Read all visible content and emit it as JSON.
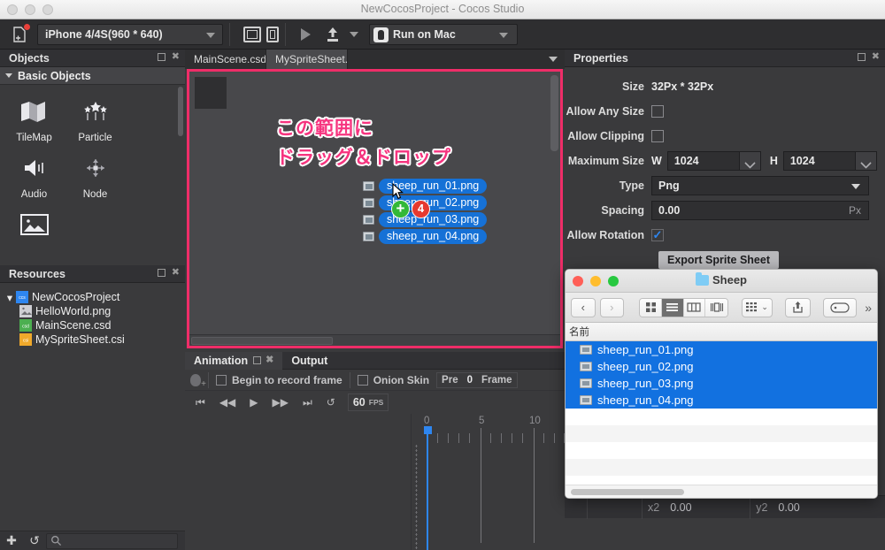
{
  "window": {
    "title": "NewCocosProject - Cocos Studio"
  },
  "toolbar": {
    "new_icon": "new-document-icon",
    "resolution": "iPhone 4/4S(960 * 640)",
    "landscape_icon": "landscape-orientation-icon",
    "portrait_icon": "portrait-orientation-icon",
    "play_icon": "play-icon",
    "publish_icon": "publish-icon",
    "publish_caret_icon": "chevron-down-icon",
    "run_target": "Run on Mac",
    "mac_icon": "apple-mac-icon"
  },
  "objects_panel": {
    "title": "Objects",
    "group": "Basic Objects",
    "items": [
      {
        "label": "TileMap",
        "icon": "tilemap-icon"
      },
      {
        "label": "Particle",
        "icon": "particle-icon"
      },
      {
        "label": "Audio",
        "icon": "audio-icon"
      },
      {
        "label": "Node",
        "icon": "node-icon"
      },
      {
        "label": "",
        "icon": "image-icon"
      }
    ]
  },
  "resources_panel": {
    "title": "Resources",
    "tree": [
      {
        "label": "NewCocosProject",
        "icon": "ccs-project-icon",
        "depth": 0,
        "expanded": true
      },
      {
        "label": "HelloWorld.png",
        "icon": "png-image-icon",
        "depth": 1
      },
      {
        "label": "MainScene.csd",
        "icon": "csd-file-icon",
        "depth": 1
      },
      {
        "label": "MySpriteSheet.csi",
        "icon": "csi-file-icon",
        "depth": 1
      }
    ],
    "footer": {
      "add_icon": "plus-icon",
      "refresh_icon": "refresh-icon",
      "search_icon": "search-icon",
      "search_value": "",
      "search_placeholder": ""
    }
  },
  "editor_tabs": [
    {
      "label": "MainScene.csd",
      "active": false,
      "close_icon": "close-icon"
    },
    {
      "label": "MySpriteSheet.csi",
      "active": true,
      "close_icon": "close-icon"
    }
  ],
  "canvas": {
    "annotation_line1": "この範囲に",
    "annotation_line2": "ドラッグ＆ドロップ",
    "annotation_color": "#f6347f",
    "highlight_border_color": "#ef2d68",
    "drag_items": [
      "sheep_run_01.png",
      "sheep_run_02.png",
      "sheep_run_03.png",
      "sheep_run_04.png"
    ],
    "drag_badge_plus": "+",
    "drag_badge_count": "4",
    "cursor_icon": "mouse-pointer-icon",
    "arrow_icon": "pink-arrow-icon"
  },
  "properties_panel": {
    "title": "Properties",
    "rows": {
      "size_label": "Size",
      "size_value": "32Px * 32Px",
      "allow_any_size_label": "Allow Any Size",
      "allow_any_size_checked": false,
      "allow_clipping_label": "Allow Clipping",
      "allow_clipping_checked": false,
      "maximum_size_label": "Maximum Size",
      "w_label": "W",
      "w_value": "1024",
      "h_label": "H",
      "h_value": "1024",
      "type_label": "Type",
      "type_value": "Png",
      "spacing_label": "Spacing",
      "spacing_value": "0.00",
      "spacing_unit": "Px",
      "allow_rotation_label": "Allow Rotation",
      "allow_rotation_checked": true,
      "export_button": "Export Sprite Sheet"
    }
  },
  "animation_panel": {
    "tabs": [
      {
        "label": "Animation",
        "active": true
      },
      {
        "label": "Output",
        "active": false
      }
    ],
    "record_icon": "record-frame-icon",
    "begin_record_label": "Begin to record frame",
    "begin_record_checked": false,
    "onion_skin_label": "Onion Skin",
    "onion_skin_checked": false,
    "pre_label": "Pre",
    "pre_value": "0",
    "frame_label": "Frame",
    "transport": {
      "first_icon": "skip-to-start-icon",
      "rewind_icon": "rewind-icon",
      "play_icon": "play-icon",
      "forward_icon": "fast-forward-icon",
      "last_icon": "skip-to-end-icon",
      "loop_icon": "loop-icon"
    },
    "fps_value": "60",
    "fps_unit": "FPS",
    "row_caret_icon": "chevron-down-icon",
    "edit_icon": "pencil-icon",
    "add_icon": "plus-icon",
    "timeline": {
      "labels": [
        "0",
        "5",
        "10"
      ],
      "playhead_frame": "0"
    }
  },
  "finder": {
    "folder_name": "Sheep",
    "folder_icon": "folder-icon",
    "back_icon": "chevron-left-icon",
    "forward_icon": "chevron-right-icon",
    "view_icons": [
      "icon-view-icon",
      "list-view-icon",
      "column-view-icon",
      "gallery-view-icon"
    ],
    "view_selected_index": 1,
    "arrange_icon": "arrange-icon",
    "share_icon": "share-icon",
    "tag_icon": "tag-icon",
    "more_icon": "chevron-double-right-icon",
    "column_header": "名前",
    "files": [
      {
        "name": "sheep_run_01.png",
        "selected": true,
        "icon": "png-file-icon"
      },
      {
        "name": "sheep_run_02.png",
        "selected": true,
        "icon": "png-file-icon"
      },
      {
        "name": "sheep_run_03.png",
        "selected": true,
        "icon": "png-file-icon"
      },
      {
        "name": "sheep_run_04.png",
        "selected": true,
        "icon": "png-file-icon"
      }
    ],
    "selection_color": "#1271e0"
  },
  "bottom_strip": {
    "x2_label": "x2",
    "x2_value": "0.00",
    "y2_label": "y2",
    "y2_value": "0.00"
  }
}
